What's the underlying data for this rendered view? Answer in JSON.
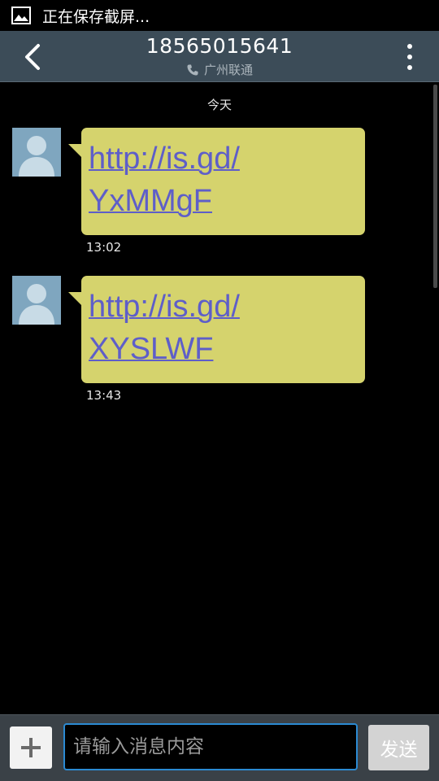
{
  "status_bar": {
    "notification_icon": "image-icon",
    "text": "正在保存截屏..."
  },
  "header": {
    "back_icon": "chevron-left-icon",
    "title": "18565015641",
    "subtitle_icon": "phone-icon",
    "subtitle": "广州联通",
    "menu_icon": "more-vert-icon"
  },
  "conversation": {
    "date_separator": "今天",
    "messages": [
      {
        "avatar": "person-avatar-icon",
        "link_line1": "http://is.gd/",
        "link_line2": "YxMMgF",
        "time": "13:02"
      },
      {
        "avatar": "person-avatar-icon",
        "link_line1": "http://is.gd/",
        "link_line2": "XYSLWF",
        "time": "13:43"
      }
    ]
  },
  "composer": {
    "add_icon": "plus-icon",
    "input_value": "",
    "input_placeholder": "请输入消息内容",
    "send_label": "发送"
  },
  "colors": {
    "header_bg": "#3c4c58",
    "bubble_bg": "#d5d36d",
    "link": "#5e5ec9",
    "input_border": "#2b8ad2",
    "avatar_bg": "#7fa6bf"
  }
}
